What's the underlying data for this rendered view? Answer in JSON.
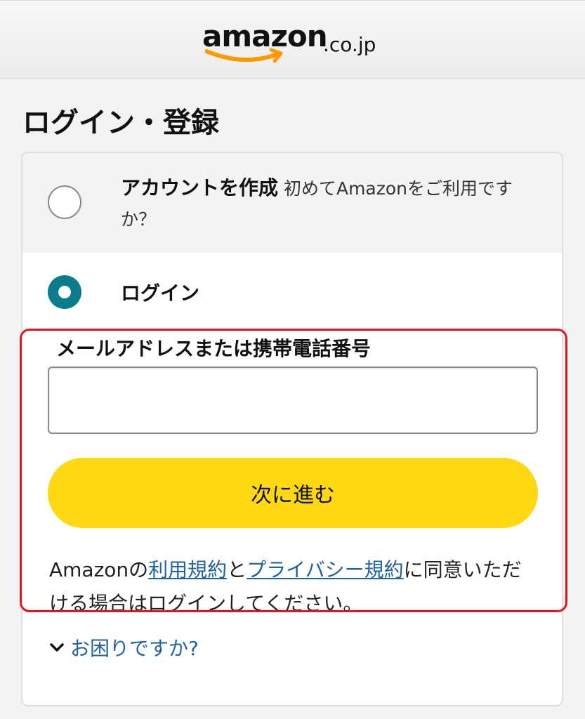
{
  "header": {
    "logo_word": "amazon",
    "logo_tld": ".co.jp"
  },
  "page": {
    "title": "ログイン・登録"
  },
  "create_account": {
    "label": "アカウントを作成",
    "description": "初めてAmazonをご利用ですか？",
    "selected": false
  },
  "login": {
    "label": "ログイン",
    "selected": true,
    "field_label": "メールアドレスまたは携帯電話番号",
    "email_value": "",
    "continue_label": "次に進む"
  },
  "terms": {
    "prefix": "Amazonの",
    "link1": "利用規約",
    "middle": "と",
    "link2": "プライバシー規約",
    "suffix": "に同意いただける場合はログインしてください。"
  },
  "help": {
    "label": "お困りですか?"
  },
  "colors": {
    "accent_yellow": "#ffd814",
    "radio_teal": "#0a7c8c",
    "link_blue": "#2162a1",
    "highlight_red": "#e0151f"
  },
  "icons": {
    "logo": "amazon-smile-logo",
    "help_toggle": "chevron-down-icon"
  }
}
